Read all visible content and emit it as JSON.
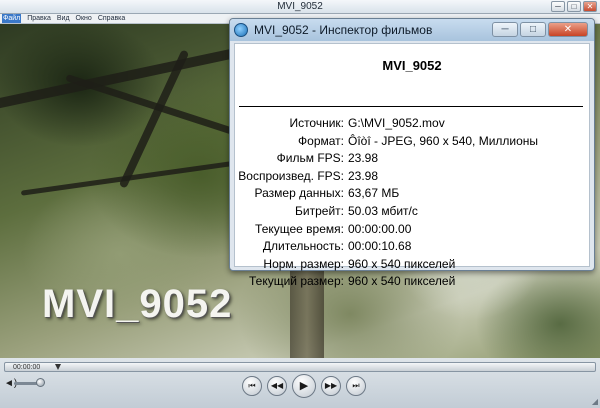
{
  "player": {
    "title": "MVI_9052",
    "window_buttons": {
      "minimize": "─",
      "maximize": "□",
      "close": "✕"
    },
    "menu": [
      "Файл",
      "Правка",
      "Вид",
      "Окно",
      "Справка"
    ],
    "video_caption": "MVI_9052"
  },
  "inspector": {
    "title": "MVI_9052 - Инспектор фильмов",
    "buttons": {
      "minimize": "─",
      "maximize": "□",
      "close": "✕"
    },
    "heading": "MVI_9052",
    "rows": [
      {
        "label": "Источник:",
        "value": "G:\\MVI_9052.mov"
      },
      {
        "label": "Формат:",
        "value": "Ôîòî - JPEG, 960 x 540, Миллионы"
      },
      {
        "label": "Фильм FPS:",
        "value": "23.98"
      },
      {
        "label": "Воспроизвед. FPS:",
        "value": "23.98"
      },
      {
        "label": "Размер данных:",
        "value": "63,67 МБ"
      },
      {
        "label": "Битрейт:",
        "value": "50.03 мбит/с"
      },
      {
        "label": "Текущее время:",
        "value": "00:00:00.00"
      },
      {
        "label": "Длительность:",
        "value": "00:00:10.68"
      },
      {
        "label": "Норм. размер:",
        "value": "960 x 540 пикселей"
      },
      {
        "label": "Текущий размер:",
        "value": "960 x 540 пикселей"
      }
    ]
  },
  "controls": {
    "time_readout": "00:00:00",
    "playback_position": 0,
    "buttons": {
      "skip_back": "⏮",
      "rewind": "◀◀",
      "play": "▶",
      "fast_forward": "▶▶",
      "skip_forward": "⏭"
    }
  }
}
